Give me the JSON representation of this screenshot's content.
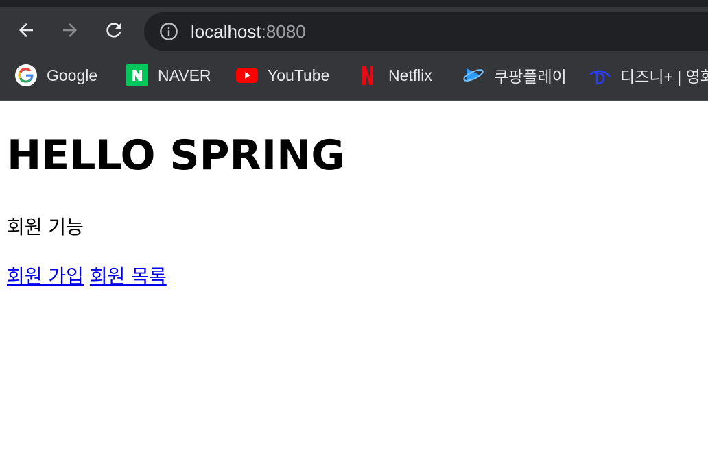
{
  "browser": {
    "url_host": "localhost",
    "url_port": ":8080",
    "bookmarks": [
      {
        "label": "Google",
        "icon": "google-icon"
      },
      {
        "label": "NAVER",
        "icon": "naver-icon"
      },
      {
        "label": "YouTube",
        "icon": "youtube-icon"
      },
      {
        "label": "Netflix",
        "icon": "netflix-icon"
      },
      {
        "label": "쿠팡플레이",
        "icon": "coupang-play-icon"
      },
      {
        "label": "디즈니+ | 영화",
        "icon": "disney-plus-icon"
      }
    ],
    "colors": {
      "frame": "#35363a",
      "omnibox": "#202124",
      "text": "#e8eaed"
    }
  },
  "page": {
    "title": "HELLO SPRING",
    "section_label": "회원 기능",
    "links": {
      "signup": "회원 가입",
      "list": "회원 목록"
    },
    "link_color": "#0000ee"
  }
}
